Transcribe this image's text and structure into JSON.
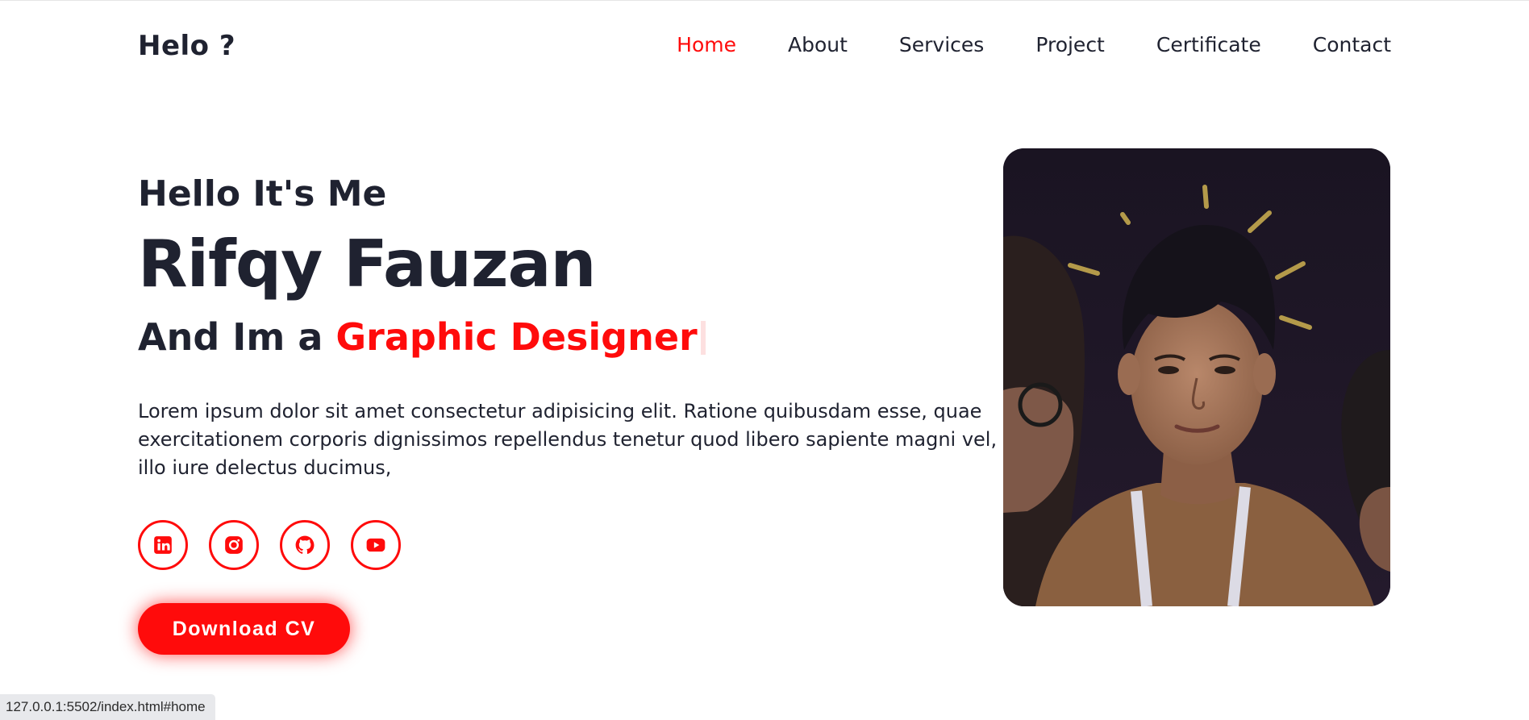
{
  "header": {
    "logo": "Helo ?",
    "nav": [
      {
        "label": "Home",
        "active": true
      },
      {
        "label": "About",
        "active": false
      },
      {
        "label": "Services",
        "active": false
      },
      {
        "label": "Project",
        "active": false
      },
      {
        "label": "Certificate",
        "active": false
      },
      {
        "label": "Contact",
        "active": false
      }
    ]
  },
  "hero": {
    "greeting": "Hello It's Me",
    "name": "Rifqy Fauzan",
    "role_prefix": "And Im a",
    "role_accent": "Graphic Designer",
    "description": "Lorem ipsum dolor sit amet consectetur adipisicing elit. Ratione quibusdam esse, quae exercitationem corporis dignissimos repellendus tenetur quod libero sapiente magni vel, illo iure delectus ducimus,",
    "socials": [
      {
        "icon": "linkedin-icon"
      },
      {
        "icon": "instagram-icon"
      },
      {
        "icon": "github-icon"
      },
      {
        "icon": "youtube-icon"
      }
    ],
    "cta_label": "Download CV"
  },
  "status_bar": {
    "url": "127.0.0.1:5502/index.html#home"
  },
  "colors": {
    "accent": "#ff0b0b",
    "text": "#1f2230",
    "background": "#ffffff"
  }
}
